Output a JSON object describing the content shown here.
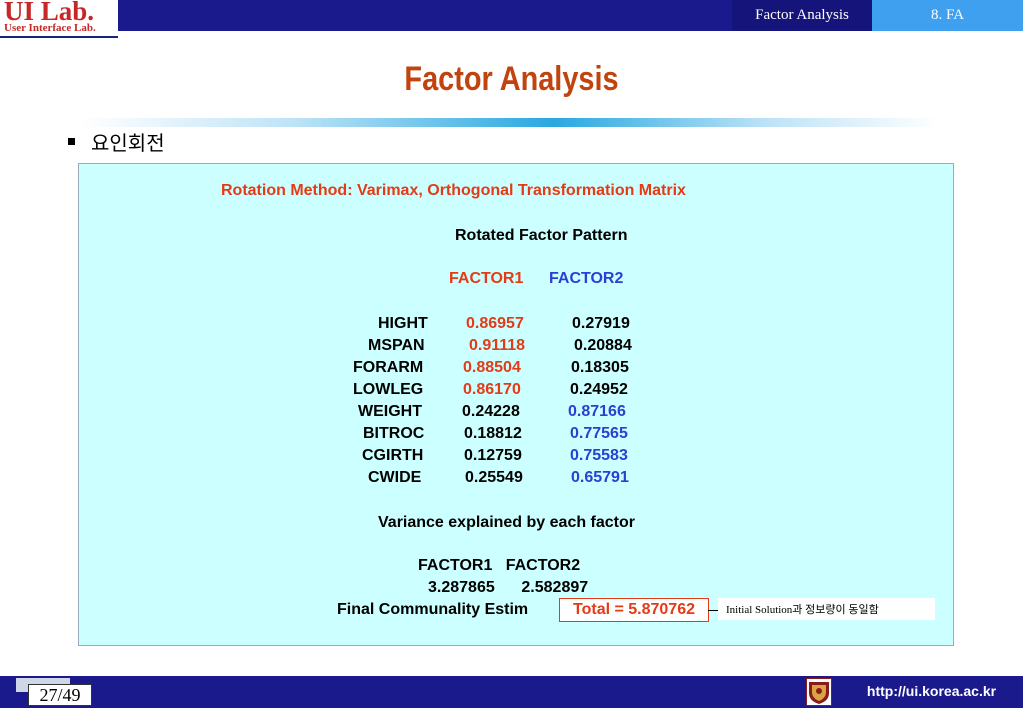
{
  "header": {
    "logo_main": "UI Lab.",
    "logo_sub": "User Interface Lab.",
    "tab_title": "Factor Analysis",
    "tab_section": "8. FA"
  },
  "slide": {
    "title": "Factor Analysis",
    "bullet": "요인회전"
  },
  "panel": {
    "heading": "Rotation Method: Varimax, Orthogonal Transformation Matrix",
    "pattern_title": "Rotated Factor Pattern",
    "factor_headers": [
      "FACTOR1",
      "FACTOR2"
    ],
    "rows": [
      {
        "var": "HIGHT",
        "f1": "0.86957",
        "f2": "0.27919"
      },
      {
        "var": "MSPAN",
        "f1": "0.91118",
        "f2": "0.20884"
      },
      {
        "var": "FORARM",
        "f1": "0.88504",
        "f2": "0.18305"
      },
      {
        "var": "LOWLEG",
        "f1": "0.86170",
        "f2": "0.24952"
      },
      {
        "var": "WEIGHT",
        "f1": "0.24228",
        "f2": "0.87166"
      },
      {
        "var": "BITROC",
        "f1": "0.18812",
        "f2": "0.77565"
      },
      {
        "var": "CGIRTH",
        "f1": "0.12759",
        "f2": "0.75583"
      },
      {
        "var": "CWIDE",
        "f1": "0.25549",
        "f2": "0.65791"
      }
    ],
    "variance_title": "Variance explained by each factor",
    "variance_headers": "FACTOR1   FACTOR2",
    "variance_values": "3.287865      2.582897",
    "communality_label": "Final Communality Estim",
    "total_label": "Total = 5.870762",
    "note": "Initial Solution과 정보량이 동일함"
  },
  "footer": {
    "page": "27/49",
    "url": "http://ui.korea.ac.kr"
  },
  "colors": {
    "bar": "#1a1a8c",
    "title": "#c1440e",
    "highlight_red": "#e43b16",
    "highlight_blue": "#2b3fd0",
    "panel_bg": "#ccffff"
  }
}
